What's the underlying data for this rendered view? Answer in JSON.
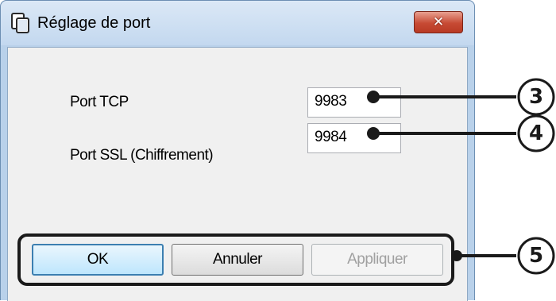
{
  "window": {
    "title": "Réglage de port",
    "close_glyph": "✕",
    "app_icon": "copy-pages-icon",
    "close_icon": "close-icon"
  },
  "fields": [
    {
      "label": "Port TCP",
      "value": "9983"
    },
    {
      "label": "Port SSL (Chiffrement)",
      "value": "9984"
    }
  ],
  "buttons": {
    "ok": "OK",
    "cancel": "Annuler",
    "apply": "Appliquer"
  },
  "callouts": [
    "③",
    "④",
    "⑤"
  ],
  "colors": {
    "frame": "#b9d1ea",
    "close": "#c74a34",
    "client": "#f0f0f0",
    "callout": "#1a1a1a"
  }
}
